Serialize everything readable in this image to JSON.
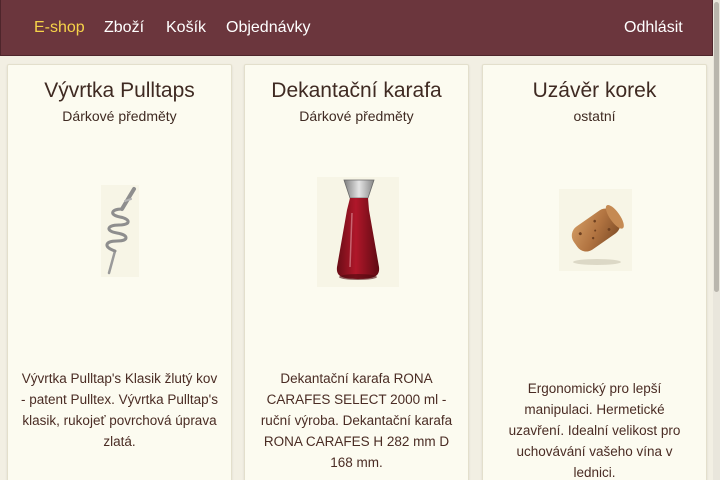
{
  "nav": {
    "brand": "E-shop",
    "items": [
      "Zboží",
      "Košík",
      "Objednávky"
    ],
    "logout": "Odhlásit"
  },
  "products": [
    {
      "title": "Vývrtka Pulltaps",
      "category": "Dárkové předměty",
      "image": "corkscrew-image",
      "description": "Vývrtka Pulltap's Klasik žlutý kov - patent Pulltex. Vývrtka Pulltap's klasik, rukojeť povrchová úprava zlatá."
    },
    {
      "title": "Dekantační karafa",
      "category": "Dárkové předměty",
      "image": "carafe-image",
      "description": "Dekantační karafa RONA CARAFES SELECT 2000 ml - ruční výroba. Dekantační karafa RONA CARAFES H 282 mm D 168 mm."
    },
    {
      "title": "Uzávěr korek",
      "category": "ostatní",
      "image": "cork-image",
      "description": "Ergonomický pro lepší manipulaci. Hermetické uzavření. Idealní velikost pro uchovávání vašeho vína v lednici."
    }
  ],
  "colors": {
    "navbar": "#6b363d",
    "brand": "#f6d349",
    "page_background": "#f2efe3",
    "card_background": "#fcfbf0",
    "text": "#3f2a22"
  }
}
